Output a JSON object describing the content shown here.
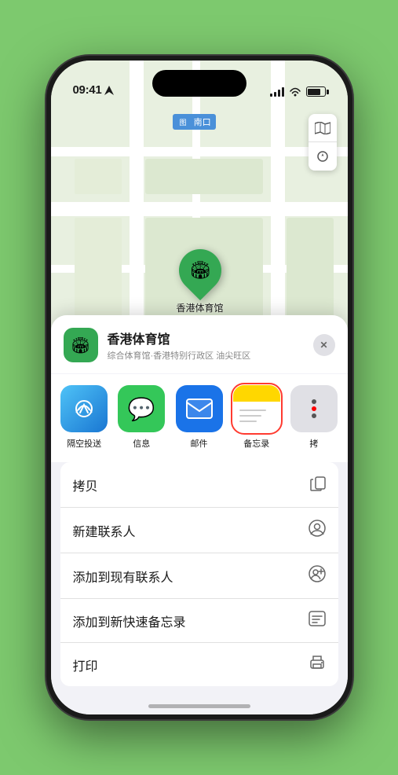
{
  "status_bar": {
    "time": "09:41",
    "location_arrow": "▶"
  },
  "map": {
    "label": "南口",
    "stadium_name": "香港体育馆"
  },
  "location_sheet": {
    "name": "香港体育馆",
    "subtitle": "综合体育馆·香港特别行政区 油尖旺区",
    "close_label": "×"
  },
  "share_items": [
    {
      "id": "airdrop",
      "label": "隔空投送"
    },
    {
      "id": "messages",
      "label": "信息"
    },
    {
      "id": "mail",
      "label": "邮件"
    },
    {
      "id": "notes",
      "label": "备忘录"
    },
    {
      "id": "more",
      "label": "拷"
    }
  ],
  "action_items": [
    {
      "id": "copy",
      "label": "拷贝"
    },
    {
      "id": "new-contact",
      "label": "新建联系人"
    },
    {
      "id": "add-existing",
      "label": "添加到现有联系人"
    },
    {
      "id": "add-quick-note",
      "label": "添加到新快速备忘录"
    },
    {
      "id": "print",
      "label": "打印"
    }
  ]
}
